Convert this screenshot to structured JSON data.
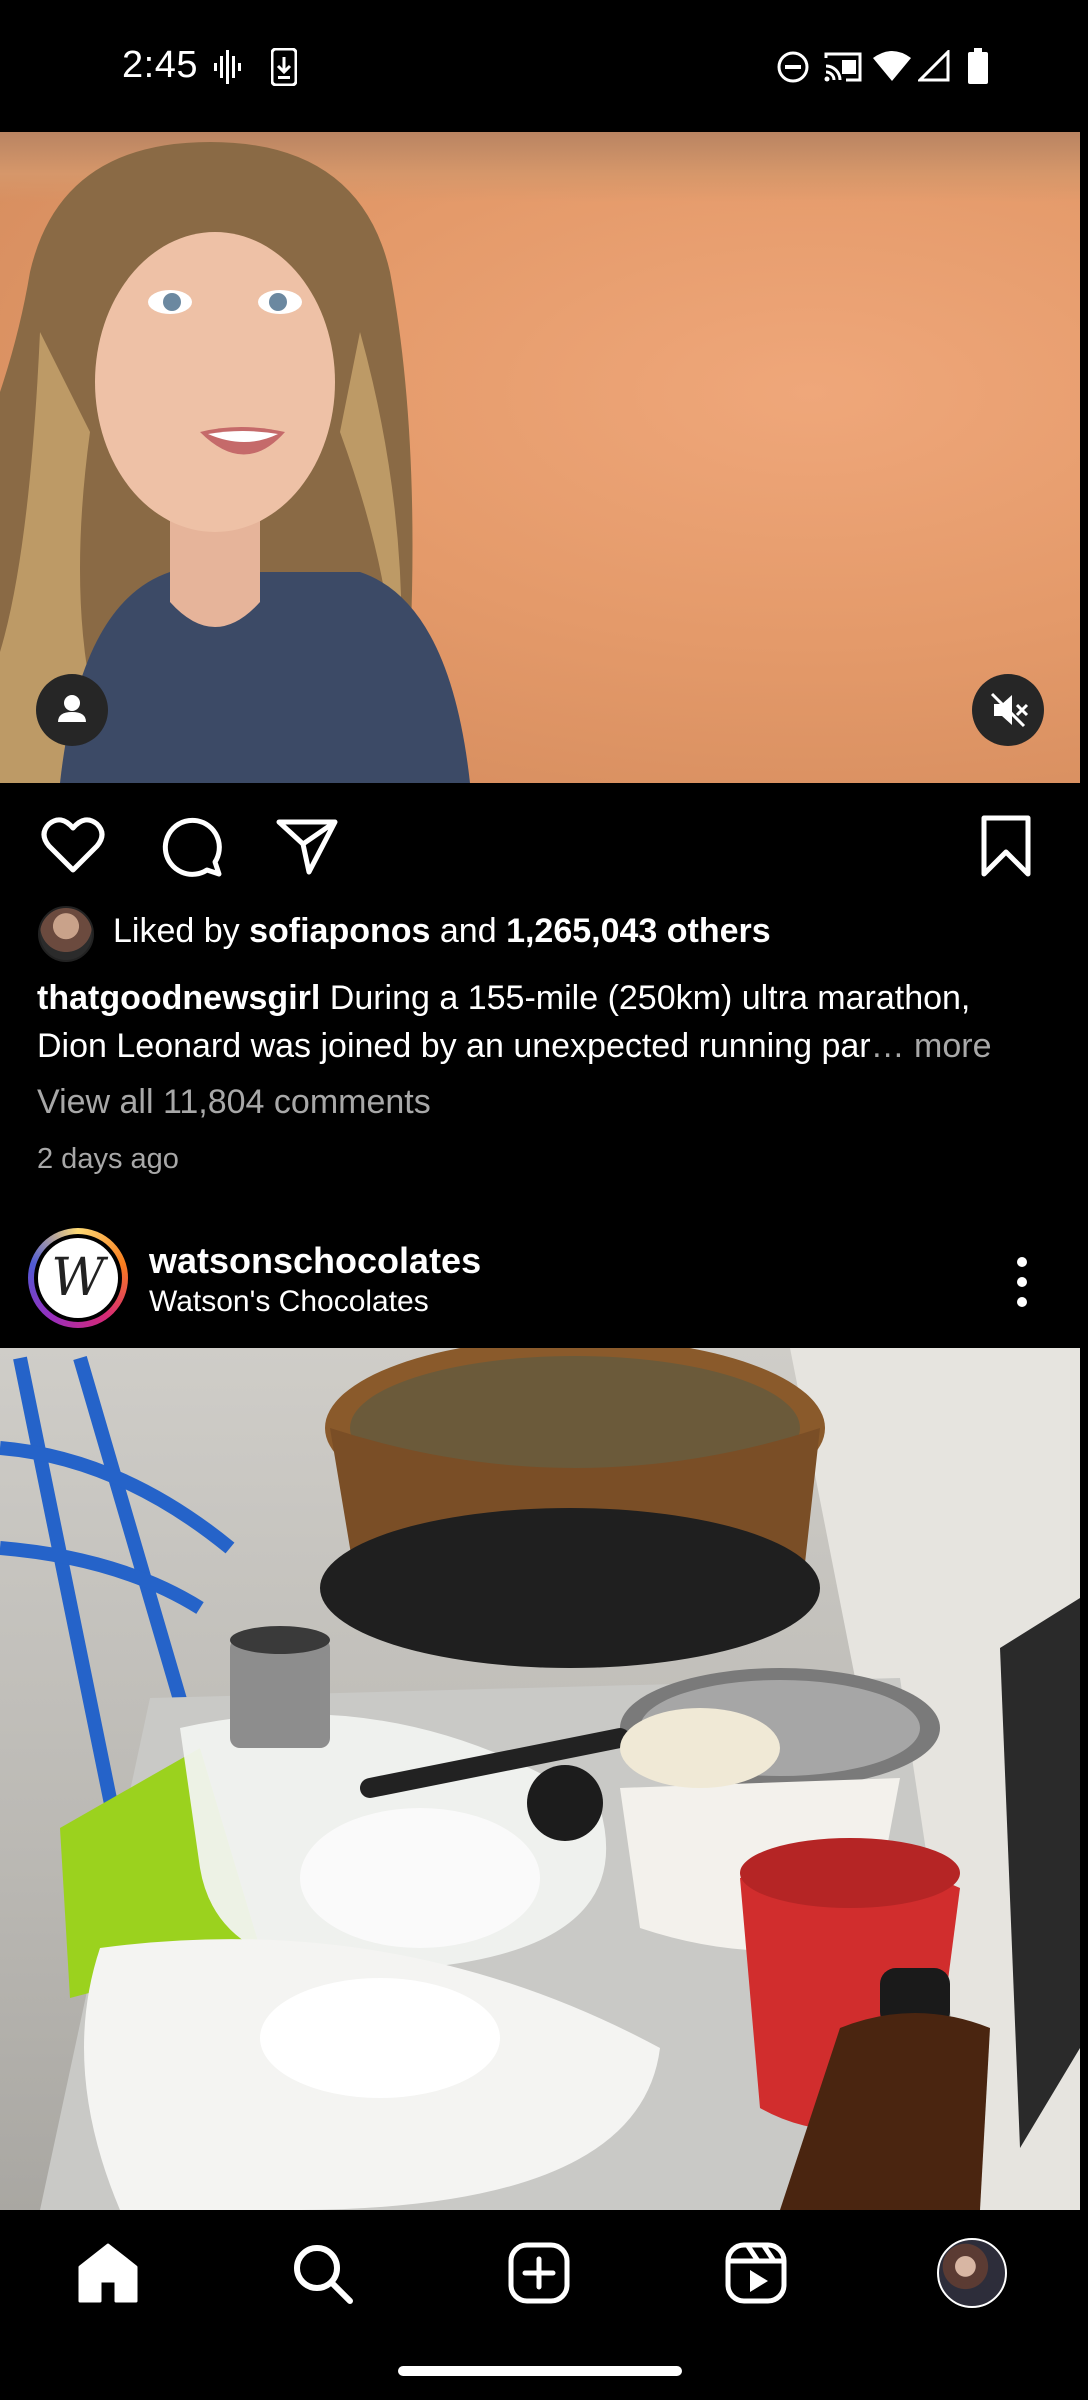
{
  "status_bar": {
    "time": "2:45",
    "left_icons": [
      "waveform-icon",
      "download-icon"
    ],
    "right_icons": [
      "do-not-disturb-icon",
      "cast-icon",
      "wifi-icon",
      "signal-icon",
      "battery-icon"
    ]
  },
  "post1": {
    "media_icons": [
      "person-tag-icon",
      "muted-speaker-icon"
    ],
    "actions": [
      "heart-icon",
      "comment-icon",
      "share-icon",
      "bookmark-icon"
    ],
    "liked_by_prefix": "Liked by ",
    "liked_by_user": "sofiaponos",
    "liked_by_and": " and ",
    "liked_by_others": "1,265,043 others",
    "caption_user": "thatgoodnewsgirl",
    "caption_text": " During a 155-mile (250km) ultra marathon, Dion Leonard was joined by an unexpected running par",
    "caption_more": "… more",
    "view_comments": "View all 11,804 comments",
    "time_ago": "2 days ago"
  },
  "post2": {
    "username": "watsonschocolates",
    "subtitle": "Watson's Chocolates",
    "avatar_letter": "W",
    "menu_icon": "more-vertical-icon"
  },
  "bottom_nav": {
    "items": [
      "home-icon",
      "search-icon",
      "create-icon",
      "reels-icon",
      "profile-avatar"
    ]
  },
  "colors": {
    "background": "#000000",
    "secondary_text": "#a8a8a8",
    "icon_button_bg": "#262626"
  }
}
